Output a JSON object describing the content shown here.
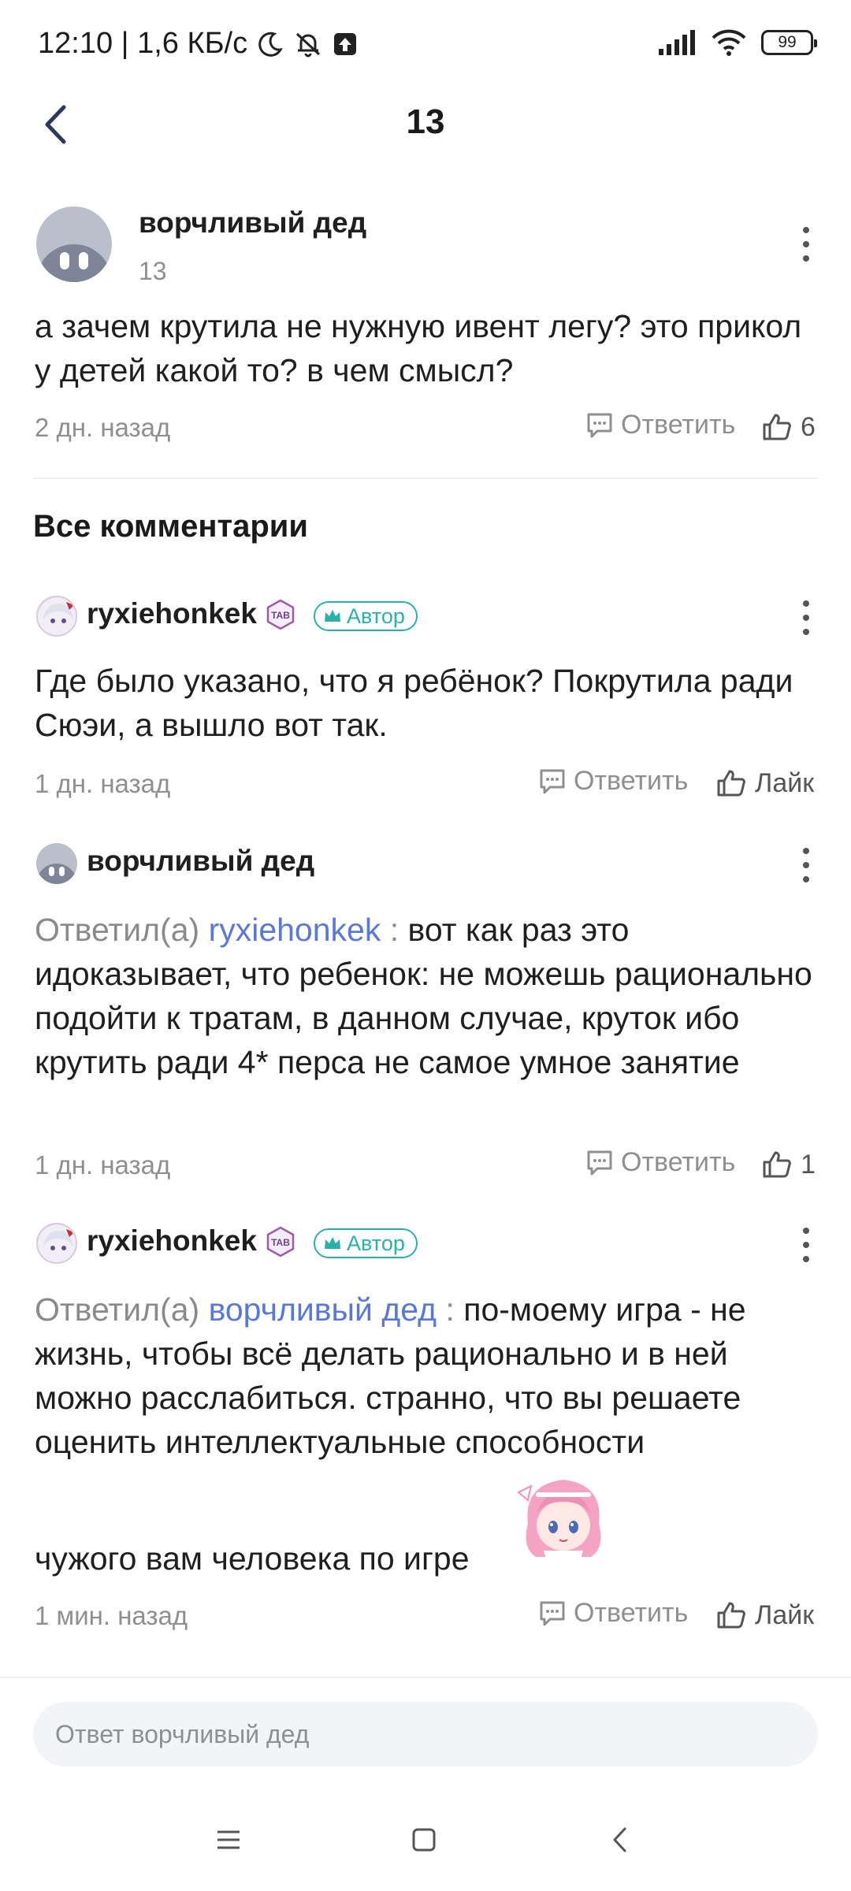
{
  "status_bar": {
    "time_speed": "12:10 | 1,6 КБ/с",
    "battery": "99"
  },
  "header": {
    "title": "13"
  },
  "root_comment": {
    "author": "ворчливый дед",
    "sub": "13",
    "text": "а зачем крутила не нужную ивент легу? это прикол у детей какой то? в чем смысл?",
    "time": "2 дн. назад",
    "reply_label": "Ответить",
    "likes": "6"
  },
  "section_title": "Все комментарии",
  "comments": [
    {
      "author": "ryxiehonkek",
      "badge": "Автор",
      "text": "Где было указано, что я ребёнок? Покрутила ради Сюэи, а вышло вот так.",
      "time": "1 дн. назад",
      "reply_label": "Ответить",
      "like_label": "Лайк"
    },
    {
      "author": "ворчливый дед",
      "replied_prefix": "Ответил(а)",
      "mention": "ryxiehonkek",
      "separator": " : ",
      "text": "вот как раз это идоказывает, что ребенок: не можешь рационально подойти к тратам, в данном случае, круток ибо крутить ради 4* перса не самое умное занятие",
      "time": "1 дн. назад",
      "reply_label": "Ответить",
      "likes": "1"
    },
    {
      "author": "ryxiehonkek",
      "badge": "Автор",
      "replied_prefix": "Ответил(а)",
      "mention": "ворчливый дед",
      "separator": " : ",
      "text": "по-моему игра - не жизнь, чтобы всё делать рационально и в ней можно расслабиться. странно, что вы решаете оценить интеллектуальные способности",
      "text_tail": "чужого вам человека по игре",
      "time": "1 мин. назад",
      "reply_label": "Ответить",
      "like_label": "Лайк"
    }
  ],
  "reply_input": {
    "placeholder": "Ответ ворчливый дед"
  },
  "colors": {
    "accent_mention": "#5a78d9",
    "author_tag": "#29b2a8",
    "muted": "#8f8f8f"
  },
  "icons": {
    "back": "chevron-left-icon",
    "more": "more-vertical-icon",
    "reply": "speech-bubble-icon",
    "like": "thumbs-up-icon"
  }
}
